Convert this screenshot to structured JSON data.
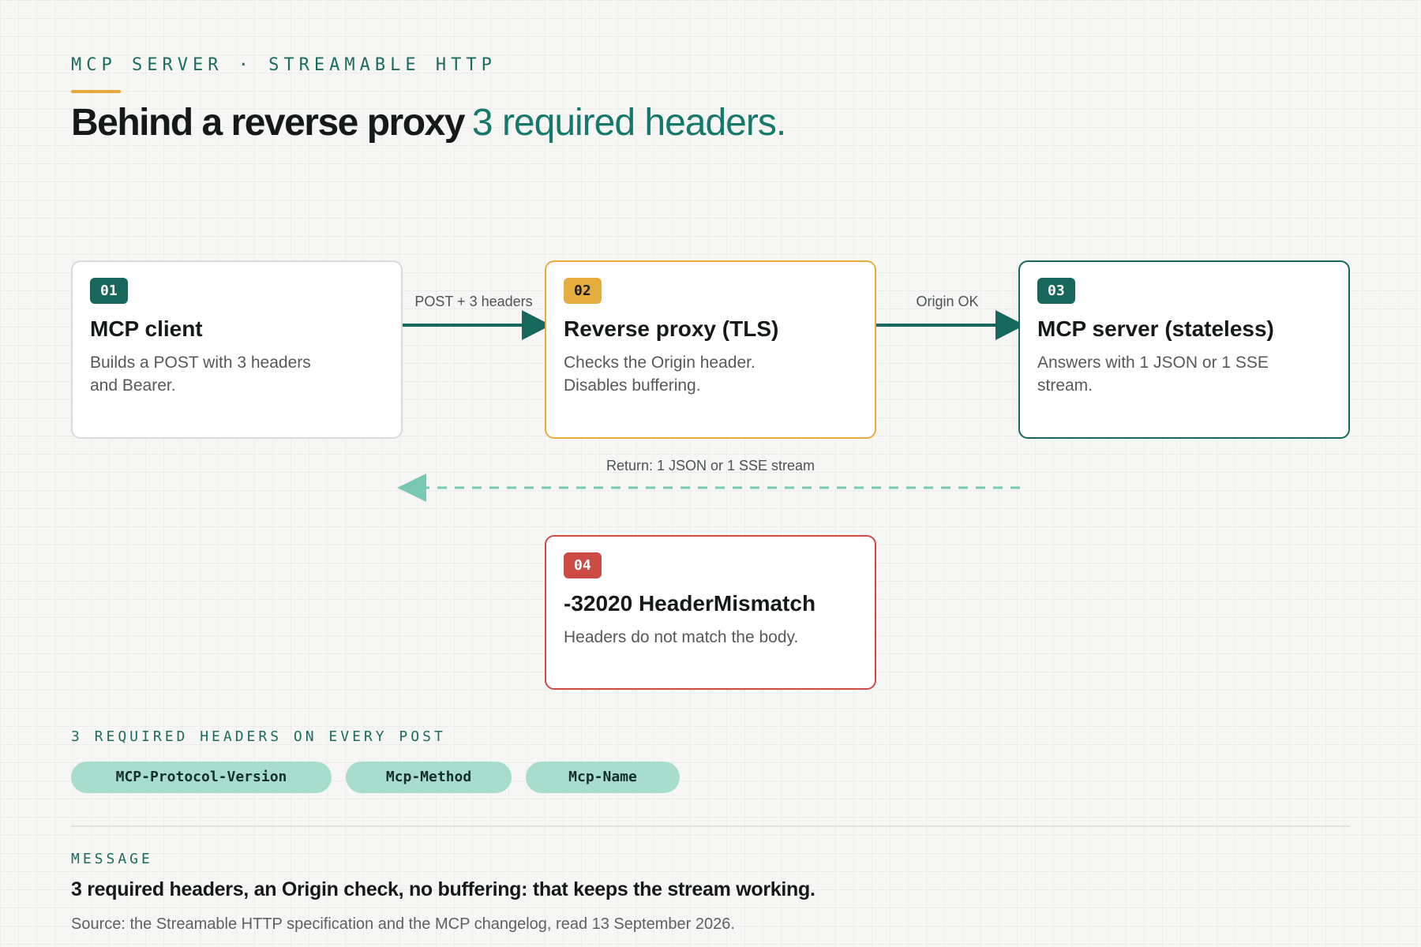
{
  "header": {
    "eyebrow": "MCP SERVER · STREAMABLE HTTP",
    "title": "Behind a reverse proxy",
    "title_accent": "3 required headers."
  },
  "nodes": [
    {
      "badge": "01",
      "title": "MCP client",
      "description": "Builds a POST with 3 headers and Bearer."
    },
    {
      "badge": "02",
      "title": "Reverse proxy (TLS)",
      "description": "Checks the Origin header. Disables buffering."
    },
    {
      "badge": "03",
      "title": "MCP server (stateless)",
      "description": "Answers with 1 JSON or 1 SSE stream."
    },
    {
      "badge": "04",
      "title": "-32020 HeaderMismatch",
      "description": "Headers do not match the body."
    }
  ],
  "edges": {
    "client_to_proxy": "POST + 3 headers",
    "proxy_to_server": "Origin OK",
    "server_to_client": "Return: 1 JSON or 1 SSE stream"
  },
  "headers_section": {
    "label": "3 REQUIRED HEADERS ON EVERY POST",
    "pills": [
      "MCP-Protocol-Version",
      "Mcp-Method",
      "Mcp-Name"
    ]
  },
  "message": {
    "label": "MESSAGE",
    "text": "3 required headers, an Origin check, no buffering: that keeps the stream working.",
    "source": "Source: the Streamable HTTP specification and the MCP changelog, read 13 September 2026."
  },
  "colors": {
    "teal": "#17675c",
    "amber": "#e5ad3f",
    "red": "#cc4b45",
    "return_arrow": "#78c8b2",
    "pill": "#a8dccc"
  }
}
